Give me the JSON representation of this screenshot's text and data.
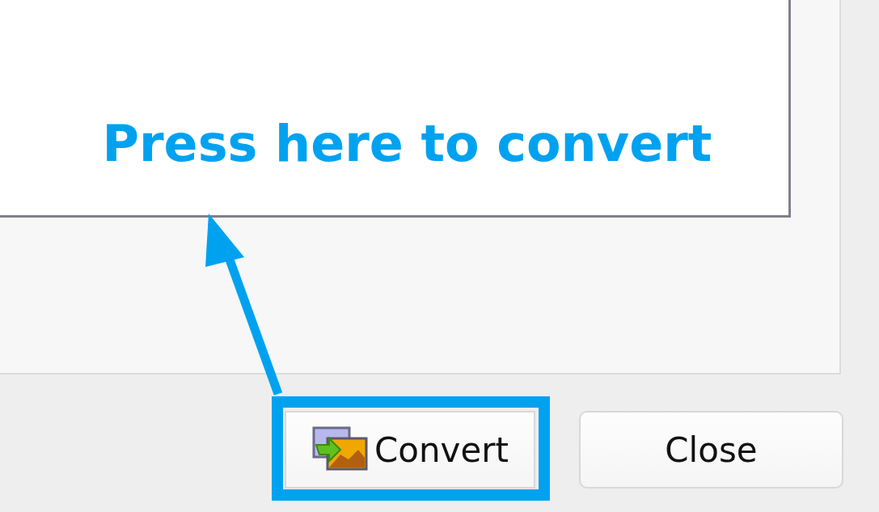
{
  "annotation": {
    "text": "Press here to convert"
  },
  "buttons": [
    {
      "label": "Convert",
      "kind": "convert",
      "highlighted": true
    },
    {
      "label": "Close",
      "kind": "close",
      "highlighted": false
    }
  ]
}
